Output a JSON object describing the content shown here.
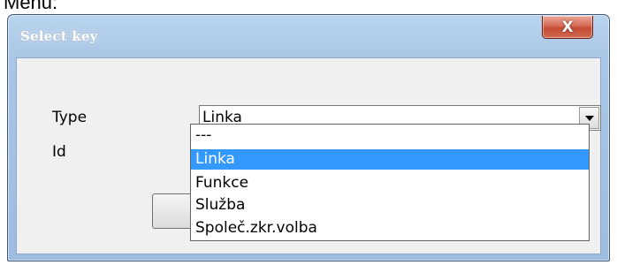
{
  "caption": "Menu:",
  "window": {
    "title": "Select key",
    "close_glyph": "X"
  },
  "form": {
    "type_label": "Type",
    "id_label": "Id",
    "type_value": "Linka"
  },
  "dropdown": {
    "options": [
      "---",
      "Linka",
      "Funkce",
      "Služba",
      "Společ.zkr.volba"
    ],
    "selected_index": 1
  },
  "ok_button": {
    "icon": "checkmark-icon",
    "glyph": "✔"
  },
  "colors": {
    "highlight": "#3399ff",
    "titlebar": "#a9c6e6",
    "close_button": "#c44b33",
    "client": "#f0f0f0",
    "checkmark": "#2e8b1e"
  }
}
